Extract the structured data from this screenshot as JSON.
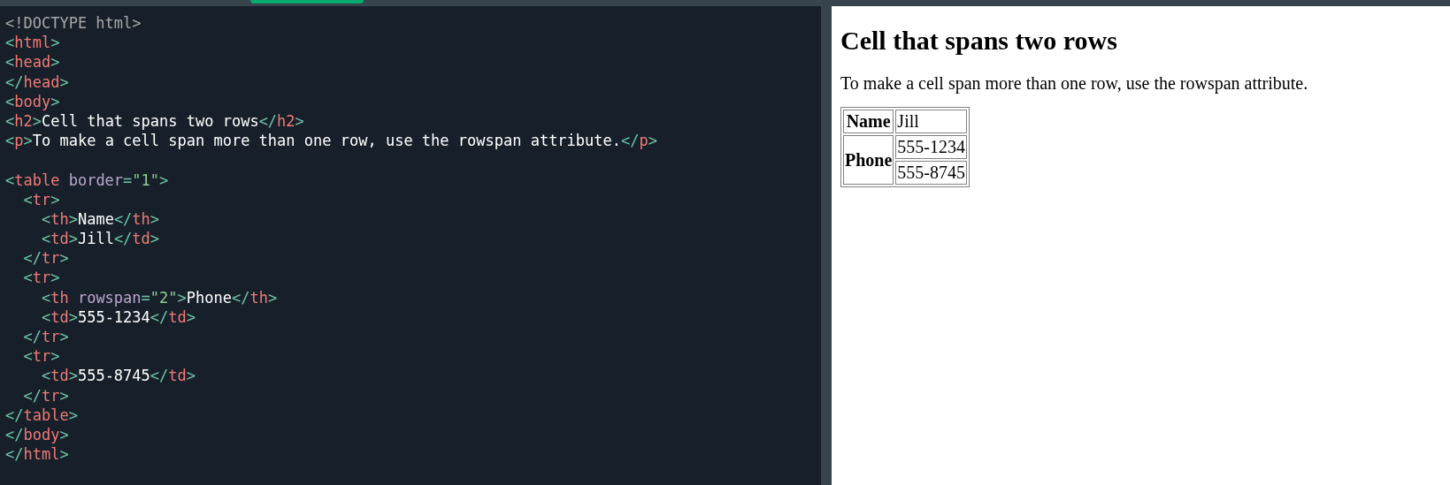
{
  "editor": {
    "lines": [
      {
        "kind": "code",
        "tokens": [
          {
            "kind": "doctype",
            "text": "<!DOCTYPE html>"
          }
        ]
      },
      {
        "kind": "code",
        "tokens": [
          {
            "kind": "punct",
            "text": "<"
          },
          {
            "kind": "tag",
            "text": "html"
          },
          {
            "kind": "punct",
            "text": ">"
          }
        ]
      },
      {
        "kind": "code",
        "tokens": [
          {
            "kind": "punct",
            "text": "<"
          },
          {
            "kind": "tag",
            "text": "head"
          },
          {
            "kind": "punct",
            "text": ">"
          }
        ]
      },
      {
        "kind": "code",
        "tokens": [
          {
            "kind": "punct",
            "text": "</"
          },
          {
            "kind": "tag",
            "text": "head"
          },
          {
            "kind": "punct",
            "text": ">"
          }
        ]
      },
      {
        "kind": "code",
        "tokens": [
          {
            "kind": "punct",
            "text": "<"
          },
          {
            "kind": "tag",
            "text": "body"
          },
          {
            "kind": "punct",
            "text": ">"
          }
        ]
      },
      {
        "kind": "code",
        "tokens": [
          {
            "kind": "punct",
            "text": "<"
          },
          {
            "kind": "tag",
            "text": "h2"
          },
          {
            "kind": "punct",
            "text": ">"
          },
          {
            "kind": "text",
            "text": "Cell that spans two rows"
          },
          {
            "kind": "punct",
            "text": "</"
          },
          {
            "kind": "tag",
            "text": "h2"
          },
          {
            "kind": "punct",
            "text": ">"
          }
        ]
      },
      {
        "kind": "code",
        "tokens": [
          {
            "kind": "punct",
            "text": "<"
          },
          {
            "kind": "tag",
            "text": "p"
          },
          {
            "kind": "punct",
            "text": ">"
          },
          {
            "kind": "text",
            "text": "To make a cell span more than one row, use the rowspan attribute."
          },
          {
            "kind": "punct",
            "text": "</"
          },
          {
            "kind": "tag",
            "text": "p"
          },
          {
            "kind": "punct",
            "text": ">"
          }
        ]
      },
      {
        "kind": "blank"
      },
      {
        "kind": "code",
        "tokens": [
          {
            "kind": "punct",
            "text": "<"
          },
          {
            "kind": "tag",
            "text": "table"
          },
          {
            "kind": "attr",
            "text": " border"
          },
          {
            "kind": "punct",
            "text": "="
          },
          {
            "kind": "value",
            "text": "\"1\""
          },
          {
            "kind": "punct",
            "text": ">"
          }
        ],
        "children": [
          {
            "kind": "code",
            "tokens": [
              {
                "kind": "punct",
                "text": "<"
              },
              {
                "kind": "tag",
                "text": "tr"
              },
              {
                "kind": "punct",
                "text": ">"
              }
            ],
            "children": [
              {
                "kind": "code",
                "tokens": [
                  {
                    "kind": "punct",
                    "text": "<"
                  },
                  {
                    "kind": "tag",
                    "text": "th"
                  },
                  {
                    "kind": "punct",
                    "text": ">"
                  },
                  {
                    "kind": "text",
                    "text": "Name"
                  },
                  {
                    "kind": "punct",
                    "text": "</"
                  },
                  {
                    "kind": "tag",
                    "text": "th"
                  },
                  {
                    "kind": "punct",
                    "text": ">"
                  }
                ]
              },
              {
                "kind": "code",
                "tokens": [
                  {
                    "kind": "punct",
                    "text": "<"
                  },
                  {
                    "kind": "tag",
                    "text": "td"
                  },
                  {
                    "kind": "punct",
                    "text": ">"
                  },
                  {
                    "kind": "text",
                    "text": "Jill"
                  },
                  {
                    "kind": "punct",
                    "text": "</"
                  },
                  {
                    "kind": "tag",
                    "text": "td"
                  },
                  {
                    "kind": "punct",
                    "text": ">"
                  }
                ]
              }
            ]
          },
          {
            "kind": "code",
            "tokens": [
              {
                "kind": "punct",
                "text": "</"
              },
              {
                "kind": "tag",
                "text": "tr"
              },
              {
                "kind": "punct",
                "text": ">"
              }
            ]
          },
          {
            "kind": "code",
            "tokens": [
              {
                "kind": "punct",
                "text": "<"
              },
              {
                "kind": "tag",
                "text": "tr"
              },
              {
                "kind": "punct",
                "text": ">"
              }
            ],
            "children": [
              {
                "kind": "code",
                "tokens": [
                  {
                    "kind": "punct",
                    "text": "<"
                  },
                  {
                    "kind": "tag",
                    "text": "th"
                  },
                  {
                    "kind": "attr",
                    "text": " rowspan"
                  },
                  {
                    "kind": "punct",
                    "text": "="
                  },
                  {
                    "kind": "value",
                    "text": "\"2\""
                  },
                  {
                    "kind": "punct",
                    "text": ">"
                  },
                  {
                    "kind": "text",
                    "text": "Phone"
                  },
                  {
                    "kind": "punct",
                    "text": "</"
                  },
                  {
                    "kind": "tag",
                    "text": "th"
                  },
                  {
                    "kind": "punct",
                    "text": ">"
                  }
                ]
              },
              {
                "kind": "code",
                "tokens": [
                  {
                    "kind": "punct",
                    "text": "<"
                  },
                  {
                    "kind": "tag",
                    "text": "td"
                  },
                  {
                    "kind": "punct",
                    "text": ">"
                  },
                  {
                    "kind": "text",
                    "text": "555-1234"
                  },
                  {
                    "kind": "punct",
                    "text": "</"
                  },
                  {
                    "kind": "tag",
                    "text": "td"
                  },
                  {
                    "kind": "punct",
                    "text": ">"
                  }
                ]
              }
            ]
          },
          {
            "kind": "code",
            "tokens": [
              {
                "kind": "punct",
                "text": "</"
              },
              {
                "kind": "tag",
                "text": "tr"
              },
              {
                "kind": "punct",
                "text": ">"
              }
            ]
          },
          {
            "kind": "code",
            "tokens": [
              {
                "kind": "punct",
                "text": "<"
              },
              {
                "kind": "tag",
                "text": "tr"
              },
              {
                "kind": "punct",
                "text": ">"
              }
            ],
            "children": [
              {
                "kind": "code",
                "tokens": [
                  {
                    "kind": "punct",
                    "text": "<"
                  },
                  {
                    "kind": "tag",
                    "text": "td"
                  },
                  {
                    "kind": "punct",
                    "text": ">"
                  },
                  {
                    "kind": "text",
                    "text": "555-8745"
                  },
                  {
                    "kind": "punct",
                    "text": "</"
                  },
                  {
                    "kind": "tag",
                    "text": "td"
                  },
                  {
                    "kind": "punct",
                    "text": ">"
                  }
                ]
              }
            ]
          },
          {
            "kind": "code",
            "tokens": [
              {
                "kind": "punct",
                "text": "</"
              },
              {
                "kind": "tag",
                "text": "tr"
              },
              {
                "kind": "punct",
                "text": ">"
              }
            ]
          }
        ]
      },
      {
        "kind": "code",
        "tokens": [
          {
            "kind": "punct",
            "text": "</"
          },
          {
            "kind": "tag",
            "text": "table"
          },
          {
            "kind": "punct",
            "text": ">"
          }
        ]
      },
      {
        "kind": "code",
        "tokens": [
          {
            "kind": "punct",
            "text": "</"
          },
          {
            "kind": "tag",
            "text": "body"
          },
          {
            "kind": "punct",
            "text": ">"
          }
        ]
      },
      {
        "kind": "code",
        "tokens": [
          {
            "kind": "punct",
            "text": "</"
          },
          {
            "kind": "tag",
            "text": "html"
          },
          {
            "kind": "punct",
            "text": ">"
          }
        ]
      }
    ]
  },
  "preview": {
    "heading": "Cell that spans two rows",
    "paragraph": "To make a cell span more than one row, use the rowspan attribute.",
    "table": {
      "rows": [
        [
          {
            "kind": "header",
            "text": "Name"
          },
          {
            "kind": "data",
            "text": "Jill"
          }
        ],
        [
          {
            "kind": "header",
            "text": "Phone",
            "rowspan": 2
          },
          {
            "kind": "data",
            "text": "555-1234"
          }
        ],
        [
          {
            "kind": "data",
            "text": "555-8745"
          }
        ]
      ]
    }
  }
}
